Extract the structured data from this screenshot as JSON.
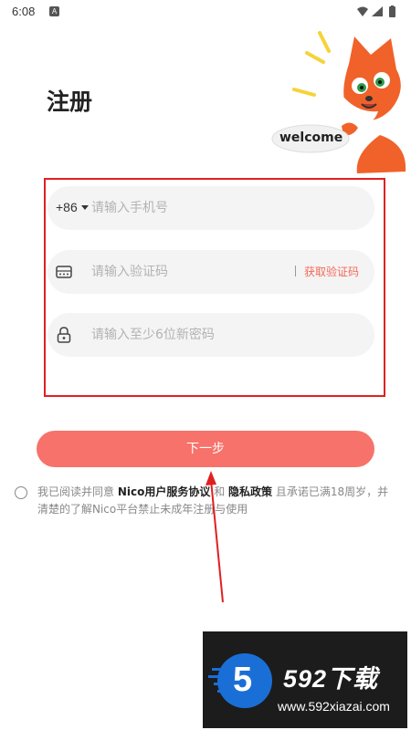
{
  "status_bar": {
    "time": "6:08",
    "notification": "A"
  },
  "page": {
    "title": "注册"
  },
  "mascot": {
    "speech": "welcome"
  },
  "form": {
    "phone": {
      "country_code": "+86",
      "placeholder": "请输入手机号",
      "value": ""
    },
    "code": {
      "placeholder": "请输入验证码",
      "value": "",
      "get_code_label": "获取验证码"
    },
    "password": {
      "placeholder": "请输入至少6位新密码",
      "value": ""
    }
  },
  "next_button": {
    "label": "下一步"
  },
  "agreement": {
    "checked": false,
    "prefix": "我已阅读并同意",
    "service_link": "Nico用户服务协议",
    "and": "和",
    "privacy_link": "隐私政策",
    "suffix": "且承诺已满18周岁，并清楚的了解Nico平台禁止未成年注册与使用"
  },
  "watermark": {
    "brand": "592下载",
    "url": "www.592xiazai.com",
    "logo_char": "5"
  },
  "colors": {
    "accent": "#f7726a",
    "link": "#f26a5a",
    "highlight": "#e02020",
    "fox": "#f0622a"
  },
  "icons": [
    "wifi-icon",
    "signal-icon",
    "battery-icon",
    "dropdown-arrow-icon",
    "sms-code-icon",
    "lock-icon",
    "radio-icon",
    "fox-mascot-icon"
  ]
}
